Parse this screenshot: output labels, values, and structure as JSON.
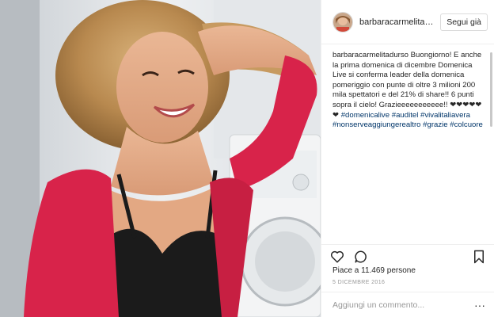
{
  "post": {
    "username": "barbaracarmelitadurso",
    "follow_label": "Segui già",
    "caption_username": "barbaracarmelitadurso",
    "caption_text": "Buongiorno! E anche la prima domenica di dicembre Domenica Live si conferma leader della domenica pomeriggio con punte di oltre 3 milioni 200 mila spettatori e del 21% di share!! 6 punti sopra il cielo! Grazieeeeeeeeeee!! ❤❤❤❤❤❤",
    "hashtags": [
      "#domenicalive",
      "#auditel",
      "#vivalitaliavera",
      "#nonserveaggiungerealtro",
      "#grazie",
      "#colcuore"
    ],
    "likes": "Piace a 11.469 persone",
    "date": "5 DICEMBRE 2016",
    "comment_placeholder": "Aggiungi un commento...",
    "more_label": "···"
  },
  "icons": {
    "like": "heart-icon",
    "comment": "comment-bubble-icon",
    "save": "bookmark-icon"
  }
}
